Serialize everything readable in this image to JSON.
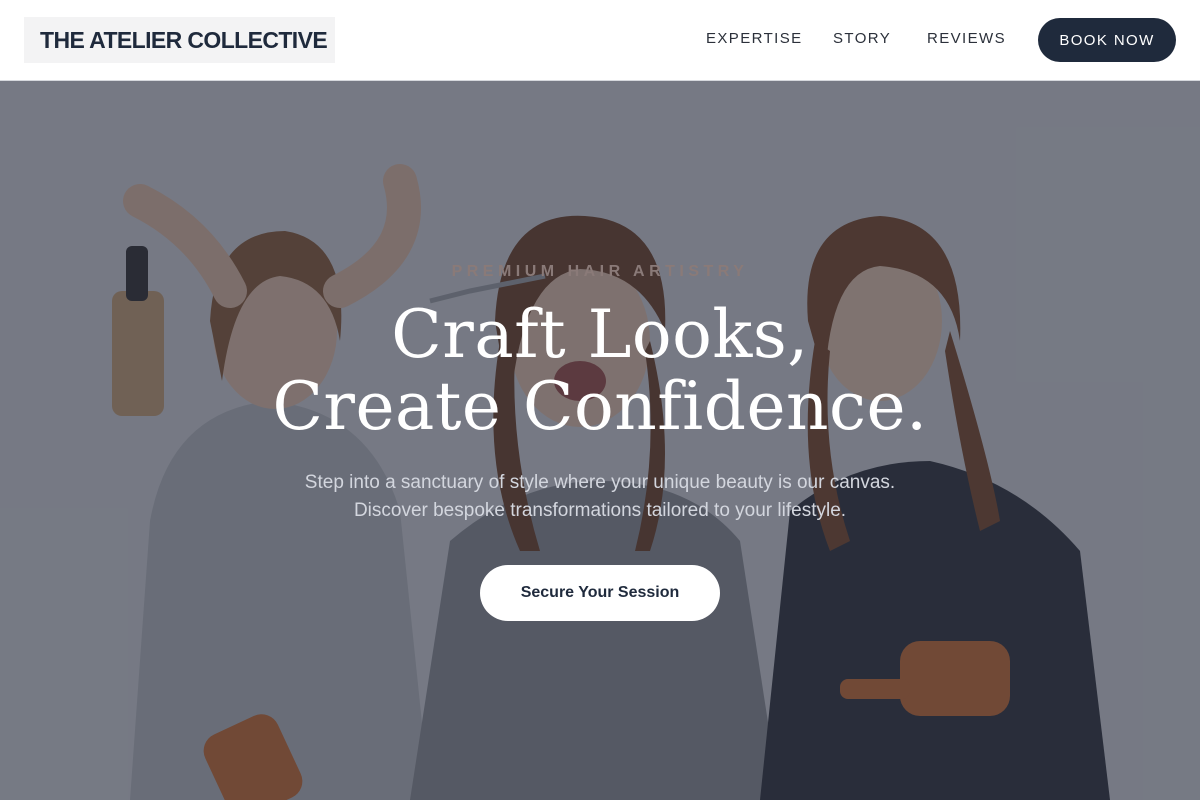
{
  "brand": {
    "name": "THE ATELIER COLLECTIVE"
  },
  "nav": {
    "links": [
      {
        "label": "EXPERTISE"
      },
      {
        "label": "STORY"
      },
      {
        "label": "REVIEWS"
      }
    ],
    "cta_label": "BOOK NOW"
  },
  "hero": {
    "eyebrow": "PREMIUM HAIR ARTISTRY",
    "headline_line1": "Craft Looks,",
    "headline_line2": "Create Confidence.",
    "subtext_line1": "Step into a sanctuary of style where your unique beauty is our canvas.",
    "subtext_line2": "Discover bespoke transformations tailored to your lifestyle.",
    "cta_label": "Secure Your Session",
    "background": "photo of three smiling hair stylists holding brushes and scissors"
  },
  "colors": {
    "brand_dark": "#1f2a3c",
    "eyebrow": "#8a7a78",
    "overlay": "#282e3e"
  }
}
